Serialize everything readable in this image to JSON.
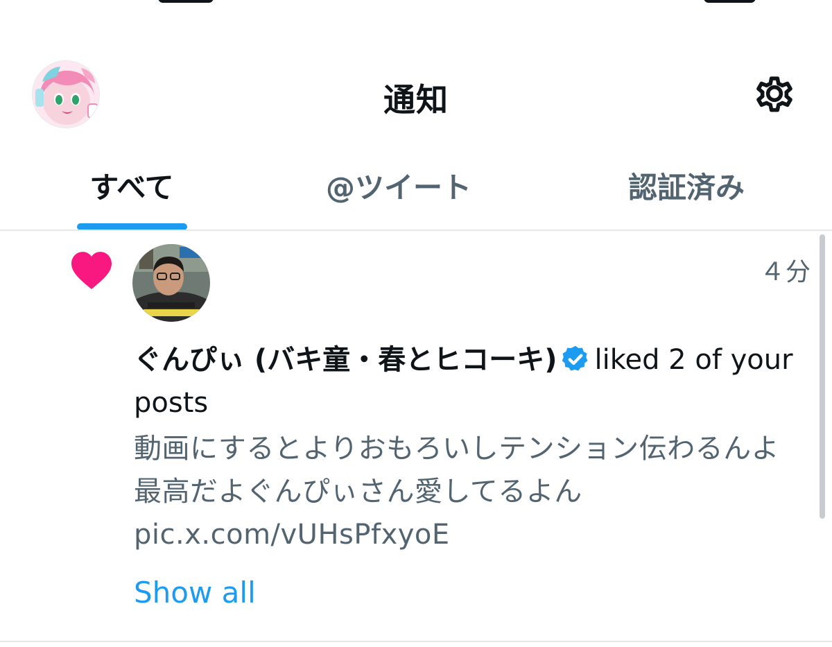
{
  "header": {
    "title": "通知",
    "avatar_icon": "user-avatar-anime-icon",
    "settings_icon": "gear-icon"
  },
  "tabs": [
    {
      "label": "すべて",
      "active": true
    },
    {
      "label": "@ツイート",
      "active": false
    },
    {
      "label": "認証済み",
      "active": false
    }
  ],
  "notification": {
    "type_icon": "heart-icon",
    "timestamp": "４分",
    "actor_name": "ぐんぴぃ (バキ童・春とヒコーキ)",
    "verified": true,
    "action_text": "liked 2 of your posts",
    "post_preview": "動画にするとよりおもろいしテンション伝わるんよ最高だよぐんぴぃさん愛してるよん pic.x.com/vUHsPfxyoE",
    "show_all_label": "Show all"
  },
  "colors": {
    "accent": "#1d9bf0",
    "like": "#f91880",
    "secondary_text": "#536471",
    "primary_text": "#0f1419"
  }
}
